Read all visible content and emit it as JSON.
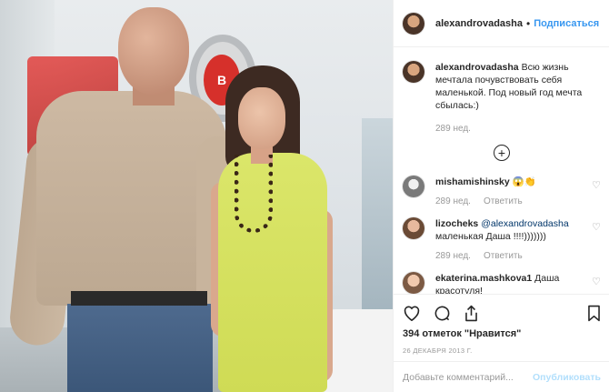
{
  "post": {
    "username": "alexandrovadasha",
    "follow_label": "Подписаться",
    "separator": "•",
    "photo_sign_text": "В",
    "caption": {
      "username": "alexandrovadasha",
      "text": "Всю жизнь мечтала почувствовать себя маленькой. Под новый год мечта сбылась:)",
      "time": "289 нед."
    },
    "load_more_icon": "plus-circle-icon",
    "comments": [
      {
        "username": "mishamishinsky",
        "text": "😱👏",
        "time": "289 нед.",
        "reply_label": "Ответить"
      },
      {
        "username": "lizocheks",
        "mention": "@alexandrovadasha",
        "text": "маленькая Даша !!!!)))))))",
        "time": "289 нед.",
        "reply_label": "Ответить"
      },
      {
        "username": "ekaterina.mashkova1",
        "text": "Даша красотуля!"
      }
    ],
    "likes": "394 отметок \"Нравится\"",
    "date": "26 ДЕКАБРЯ 2013 Г.",
    "add_comment_placeholder": "Добавьте комментарий...",
    "post_label": "Опубликовать",
    "icons": [
      "heart-icon",
      "comment-icon",
      "share-icon",
      "bookmark-icon"
    ],
    "colors": {
      "link": "#3897f0",
      "muted": "#999999",
      "post_disabled": "#b2dffc"
    }
  }
}
